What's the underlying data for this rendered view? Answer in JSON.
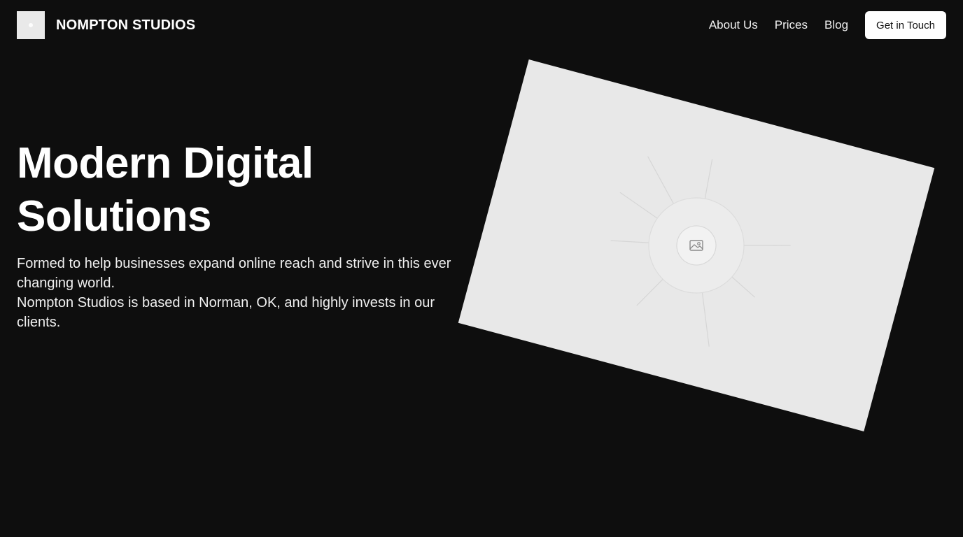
{
  "header": {
    "brand": "NOMPTON STUDIOS",
    "nav": [
      {
        "label": "About Us"
      },
      {
        "label": "Prices"
      },
      {
        "label": "Blog"
      }
    ],
    "cta_label": "Get in Touch"
  },
  "hero": {
    "title_line1": "Modern Digital",
    "title_line2": "Solutions",
    "paragraph1": "Formed to help businesses expand online reach and strive in this ever changing world.",
    "paragraph2": "Nompton Studios is based in Norman, OK, and highly invests in our clients."
  },
  "icons": {
    "logo": "logo-icon",
    "image_placeholder": "image-icon"
  },
  "colors": {
    "background": "#0e0e0e",
    "text": "#ffffff",
    "placeholder": "#e8e8e8",
    "button_bg": "#ffffff",
    "button_text": "#111111"
  }
}
